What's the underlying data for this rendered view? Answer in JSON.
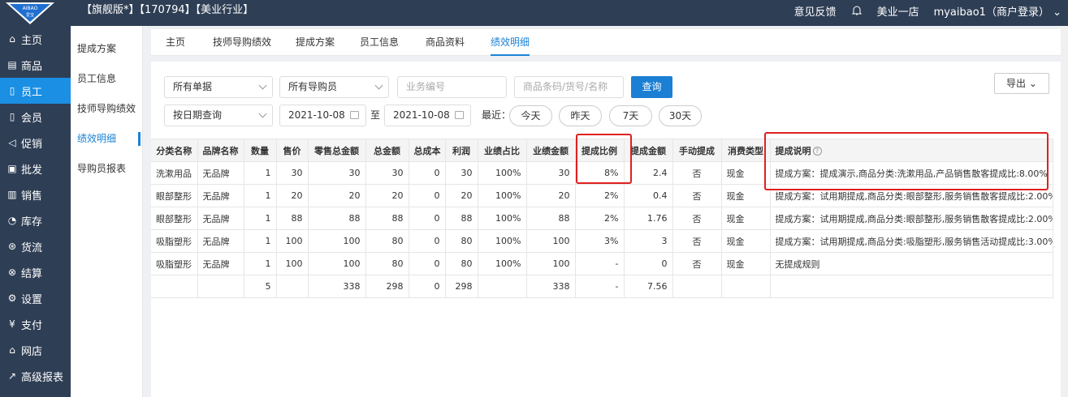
{
  "header": {
    "logo_text": "AIBAO",
    "logo_sub": "爱宝",
    "title": "【旗舰版*】【170794】【美业行业】",
    "feedback": "意见反馈",
    "store": "美业一店",
    "user": "myaibao1（商户登录）"
  },
  "sidebar": {
    "items": [
      {
        "label": "主页",
        "icon": "home-icon",
        "glyph": "⌂"
      },
      {
        "label": "商品",
        "icon": "goods-icon",
        "glyph": "▤"
      },
      {
        "label": "员工",
        "icon": "staff-icon",
        "glyph": "▯"
      },
      {
        "label": "会员",
        "icon": "member-icon",
        "glyph": "▯"
      },
      {
        "label": "促销",
        "icon": "promo-icon",
        "glyph": "◁"
      },
      {
        "label": "批发",
        "icon": "wholesale-icon",
        "glyph": "▣"
      },
      {
        "label": "销售",
        "icon": "sales-icon",
        "glyph": "▥"
      },
      {
        "label": "库存",
        "icon": "stock-icon",
        "glyph": "◔"
      },
      {
        "label": "货流",
        "icon": "flow-icon",
        "glyph": "⊛"
      },
      {
        "label": "结算",
        "icon": "settle-icon",
        "glyph": "⊗"
      },
      {
        "label": "设置",
        "icon": "settings-icon",
        "glyph": "⚙"
      },
      {
        "label": "支付",
        "icon": "pay-icon",
        "glyph": "¥"
      },
      {
        "label": "网店",
        "icon": "shop-icon",
        "glyph": "⌂"
      },
      {
        "label": "高级报表",
        "icon": "report-icon",
        "glyph": "↗"
      }
    ]
  },
  "subnav": {
    "items": [
      "提成方案",
      "员工信息",
      "技师导购绩效",
      "绩效明细",
      "导购员报表"
    ]
  },
  "tabs": [
    "主页",
    "技师导购绩效",
    "提成方案",
    "员工信息",
    "商品资料",
    "绩效明细"
  ],
  "filters": {
    "doc_type": "所有单据",
    "guide": "所有导购员",
    "biz_no_placeholder": "业务编号",
    "goods_placeholder": "商品条码/货号/名称",
    "query": "查询",
    "export": "导出",
    "date_mode": "按日期查询",
    "date_from": "2021-10-08",
    "to": "至",
    "date_to": "2021-10-08",
    "recent": "最近：",
    "quick": [
      "今天",
      "昨天",
      "7天",
      "30天"
    ]
  },
  "table": {
    "headers": [
      "分类名称",
      "品牌名称",
      "数量",
      "售价",
      "零售总金额",
      "总金额",
      "总成本",
      "利润",
      "业绩占比",
      "业绩金额",
      "提成比例",
      "提成金额",
      "手动提成",
      "消费类型",
      "提成说明"
    ],
    "rows": [
      [
        "洗漱用品",
        "无品牌",
        "1",
        "30",
        "30",
        "30",
        "0",
        "30",
        "100%",
        "30",
        "8%",
        "2.4",
        "否",
        "现金",
        "提成方案：提成演示,商品分类:洗漱用品,产品销售散客提成比:8.00%"
      ],
      [
        "眼部整形",
        "无品牌",
        "1",
        "20",
        "20",
        "20",
        "0",
        "20",
        "100%",
        "20",
        "2%",
        "0.4",
        "否",
        "现金",
        "提成方案：试用期提成,商品分类:眼部整形,服务销售散客提成比:2.00%"
      ],
      [
        "眼部整形",
        "无品牌",
        "1",
        "88",
        "88",
        "88",
        "0",
        "88",
        "100%",
        "88",
        "2%",
        "1.76",
        "否",
        "现金",
        "提成方案：试用期提成,商品分类:眼部整形,服务销售散客提成比:2.00%"
      ],
      [
        "吸脂塑形",
        "无品牌",
        "1",
        "100",
        "100",
        "80",
        "0",
        "80",
        "100%",
        "100",
        "3%",
        "3",
        "否",
        "现金",
        "提成方案：试用期提成,商品分类:吸脂塑形,服务销售活动提成比:3.00%"
      ],
      [
        "吸脂塑形",
        "无品牌",
        "1",
        "100",
        "100",
        "80",
        "0",
        "80",
        "100%",
        "100",
        "-",
        "0",
        "否",
        "现金",
        "无提成规则"
      ]
    ],
    "total": [
      "",
      "",
      "5",
      "",
      "338",
      "298",
      "0",
      "298",
      "",
      "338",
      "-",
      "7.56",
      "",
      "",
      ""
    ]
  }
}
